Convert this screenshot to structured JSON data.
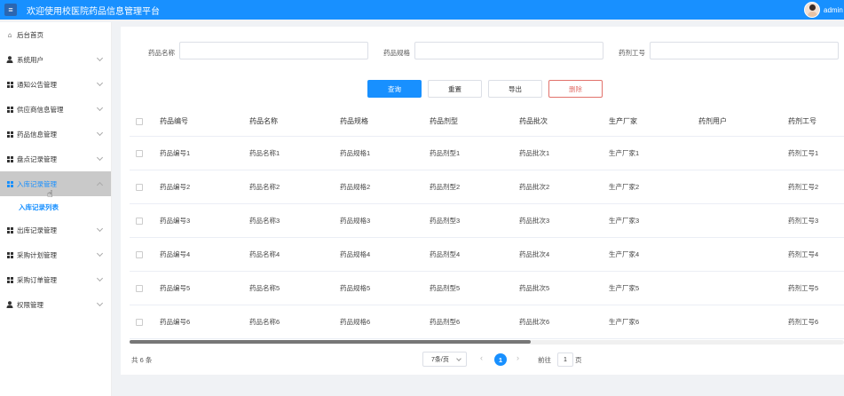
{
  "header": {
    "title": "欢迎使用校医院药品信息管理平台",
    "username": "admin",
    "menu_icon": "hamburger-icon"
  },
  "sidebar": {
    "items": [
      {
        "label": "后台首页",
        "icon": "home-icon"
      },
      {
        "label": "系统用户",
        "icon": "user-icon"
      },
      {
        "label": "通知公告管理",
        "icon": "grid-icon"
      },
      {
        "label": "供应商信息管理",
        "icon": "grid-icon"
      },
      {
        "label": "药品信息管理",
        "icon": "grid-icon"
      },
      {
        "label": "盘点记录管理",
        "icon": "grid-icon"
      },
      {
        "label": "入库记录管理",
        "icon": "grid-icon",
        "active": true
      },
      {
        "label": "出库记录管理",
        "icon": "grid-icon"
      },
      {
        "label": "采购计划管理",
        "icon": "grid-icon"
      },
      {
        "label": "采购订单管理",
        "icon": "grid-icon"
      },
      {
        "label": "权限管理",
        "icon": "user-icon"
      }
    ],
    "sub_item": "入库记录列表"
  },
  "search": {
    "name_label": "药品名称",
    "spec_label": "药品规格",
    "staff_label": "药剂工号",
    "name_value": "",
    "spec_value": "",
    "staff_value": ""
  },
  "buttons": {
    "query": "查询",
    "reset": "重置",
    "export": "导出",
    "delete": "删除"
  },
  "table": {
    "columns": [
      "药品编号",
      "药品名称",
      "药品规格",
      "药品剂型",
      "药品批次",
      "生产厂家",
      "药剂用户",
      "药剂工号"
    ],
    "rows": [
      [
        "药品编号1",
        "药品名称1",
        "药品规格1",
        "药品剂型1",
        "药品批次1",
        "生产厂家1",
        "",
        "药剂工号1"
      ],
      [
        "药品编号2",
        "药品名称2",
        "药品规格2",
        "药品剂型2",
        "药品批次2",
        "生产厂家2",
        "",
        "药剂工号2"
      ],
      [
        "药品编号3",
        "药品名称3",
        "药品规格3",
        "药品剂型3",
        "药品批次3",
        "生产厂家3",
        "",
        "药剂工号3"
      ],
      [
        "药品编号4",
        "药品名称4",
        "药品规格4",
        "药品剂型4",
        "药品批次4",
        "生产厂家4",
        "",
        "药剂工号4"
      ],
      [
        "药品编号5",
        "药品名称5",
        "药品规格5",
        "药品剂型5",
        "药品批次5",
        "生产厂家5",
        "",
        "药剂工号5"
      ],
      [
        "药品编号6",
        "药品名称6",
        "药品规格6",
        "药品剂型6",
        "药品批次6",
        "生产厂家6",
        "",
        "药剂工号6"
      ]
    ]
  },
  "pagination": {
    "total": "共 6 条",
    "page_size": "7条/页",
    "current_page": "1",
    "goto_label": "前往",
    "goto_value": "1",
    "page_suffix": "页"
  },
  "colors": {
    "primary": "#1890ff",
    "danger": "#e2726c",
    "active_menu_bg": "#c9c9c9"
  }
}
